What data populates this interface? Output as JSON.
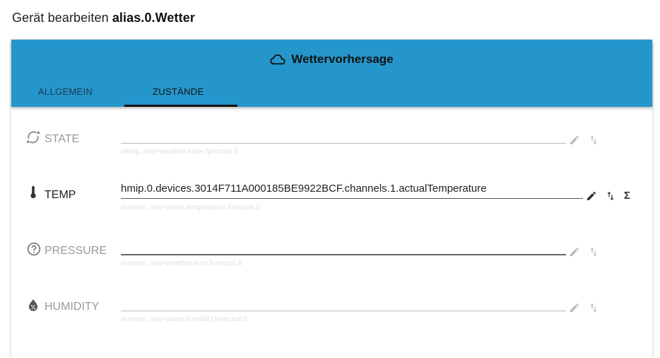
{
  "dialog": {
    "title_prefix": "Gerät bearbeiten",
    "title_id": "alias.0.Wetter"
  },
  "card": {
    "header_title": "Wettervorhersage",
    "header_icon": "cloud-icon",
    "tabs": [
      {
        "label": "ALLGEMEIN",
        "active": false
      },
      {
        "label": "ZUSTÄNDE",
        "active": true
      }
    ],
    "colors": {
      "header_bg": "#2596cc",
      "indicator": "#111111"
    }
  },
  "states": [
    {
      "name": "STATE",
      "icon": "rotate-icon",
      "value": "",
      "helper": "string, role=weather.state.fprecast.0",
      "enabled": false
    },
    {
      "name": "TEMP",
      "icon": "thermometer-icon",
      "value": "hmip.0.devices.3014F711A000185BE9922BCF.channels.1.actualTemperature",
      "helper": "number, role=value.temperature.forecast.0",
      "enabled": true
    },
    {
      "name": "PRESSURE",
      "icon": "help-circle-icon",
      "value": "",
      "helper": "number, role=weather.icon.forecast.0",
      "enabled": false
    },
    {
      "name": "HUMIDITY",
      "icon": "water-percent-icon",
      "value": "",
      "helper": "number, role=value.humidity.forecast.0",
      "enabled": false
    }
  ]
}
